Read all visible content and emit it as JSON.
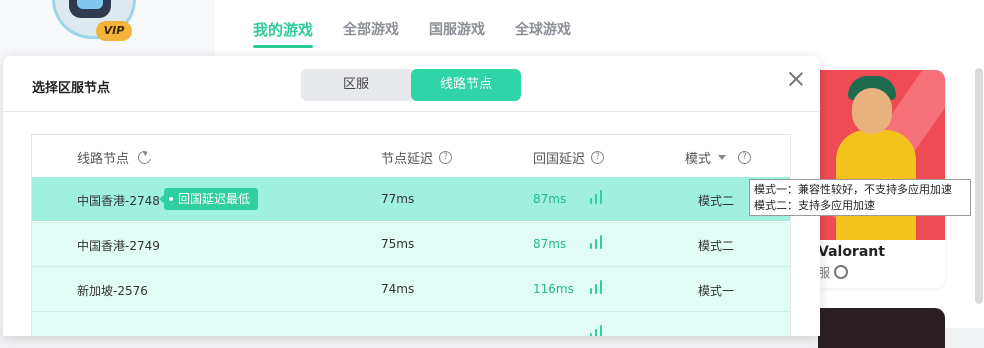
{
  "top_tabs": [
    "我的游戏",
    "全部游戏",
    "国服游戏",
    "全球游戏"
  ],
  "vip_badge": "VIP",
  "game_card": {
    "name": "Valorant",
    "region": "服"
  },
  "modal": {
    "title": "选择区服节点",
    "segment": [
      "区服",
      "线路节点"
    ],
    "active_segment": 1,
    "columns": {
      "node": "线路节点",
      "node_latency": "节点延迟",
      "return_latency": "回国延迟",
      "mode": "模式"
    },
    "rows": [
      {
        "node": "中国香港-2748",
        "badge": "回国延迟最低",
        "node_latency": "77ms",
        "return_latency": "87ms",
        "mode": "模式二",
        "selected": true
      },
      {
        "node": "中国香港-2749",
        "badge": "",
        "node_latency": "75ms",
        "return_latency": "87ms",
        "mode": "模式二",
        "selected": false
      },
      {
        "node": "新加坡-2576",
        "badge": "",
        "node_latency": "74ms",
        "return_latency": "116ms",
        "mode": "模式一",
        "selected": false
      }
    ]
  },
  "tooltip": {
    "line1": "模式一：兼容性较好，不支持多应用加速",
    "line2": "模式二：支持多应用加速"
  },
  "colors": {
    "accent": "#2fd4a7",
    "selected_row": "#9ff0dd",
    "row": "#e1fcf4",
    "latency_text": "#22b98a"
  }
}
